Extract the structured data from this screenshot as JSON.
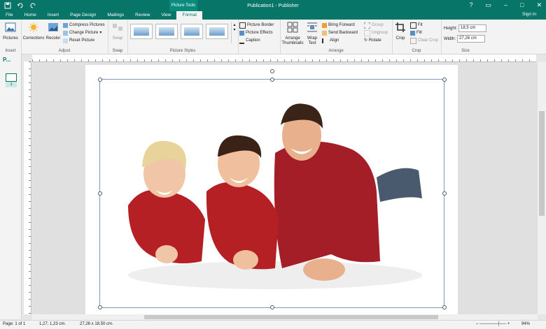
{
  "app": {
    "title": "Publication1 - Publisher",
    "context_tab_group": "Picture Tools"
  },
  "tabs": [
    {
      "label": "File"
    },
    {
      "label": "Home"
    },
    {
      "label": "Insert"
    },
    {
      "label": "Page Design"
    },
    {
      "label": "Mailings"
    },
    {
      "label": "Review"
    },
    {
      "label": "View"
    },
    {
      "label": "Format"
    }
  ],
  "sign_in": "Sign in",
  "ribbon": {
    "insert": {
      "pictures": "Pictures",
      "group": "Insert"
    },
    "adjust": {
      "corrections": "Corrections",
      "recolor": "Recolor",
      "compress": "Compress Pictures",
      "change": "Change Picture",
      "reset": "Reset Picture",
      "group": "Adjust"
    },
    "swap": {
      "swap": "Swap",
      "group": "Swap"
    },
    "picture_styles": {
      "group": "Picture Styles"
    },
    "border": {
      "border": "Picture Border",
      "effects": "Picture Effects",
      "caption": "Caption"
    },
    "arrange": {
      "thumbnails": "Arrange Thumbnails",
      "wrap": "Wrap Text",
      "forward": "Bring Forward",
      "backward": "Send Backward",
      "align": "Align",
      "group_btn": "Group",
      "ungroup": "Ungroup",
      "rotate": "Rotate",
      "group": "Arrange"
    },
    "crop": {
      "crop": "Crop",
      "fit": "Fit",
      "fill": "Fill",
      "clear": "Clear Crop",
      "group": "Crop"
    },
    "size": {
      "height_label": "Height:",
      "height_value": "18,5 cm",
      "width_label": "Width:",
      "width_value": "27,26 cm",
      "group": "Size"
    }
  },
  "pages_pane": {
    "badge": "P...",
    "page_number": "1"
  },
  "status": {
    "page": "Page: 1 of 1",
    "position": "1,27; 1,23 cm.",
    "size": "27,26 x 18,50 cm.",
    "zoom": "94%"
  },
  "colors": {
    "accent": "#077568",
    "shirt": "#b32025"
  }
}
